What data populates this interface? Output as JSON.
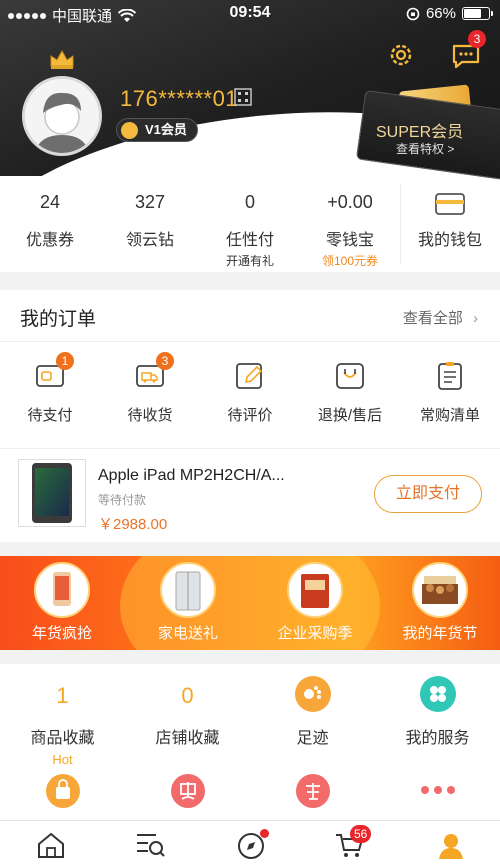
{
  "status_bar": {
    "carrier": "中国联通",
    "time": "09:54",
    "battery": "66%"
  },
  "profile": {
    "phone": "176******01",
    "vip_level": "V1会员",
    "message_badge": "3",
    "super_title": "SUPER会员",
    "super_sub": "查看特权 >"
  },
  "stats": [
    {
      "value": "24",
      "label": "优惠券",
      "sub": ""
    },
    {
      "value": "327",
      "label": "领云钻",
      "sub": ""
    },
    {
      "value": "0",
      "label": "任性付",
      "sub": "开通有礼"
    },
    {
      "value": "+0.00",
      "label": "零钱宝",
      "sub": "领100元券"
    },
    {
      "value": "",
      "label": "我的钱包",
      "sub": ""
    }
  ],
  "orders": {
    "title": "我的订单",
    "view_all": "查看全部",
    "items": [
      {
        "label": "待支付",
        "badge": "1",
        "icon": "wallet-pay-icon"
      },
      {
        "label": "待收货",
        "badge": "3",
        "icon": "truck-icon"
      },
      {
        "label": "待评价",
        "badge": "",
        "icon": "pencil-icon"
      },
      {
        "label": "退换/售后",
        "badge": "",
        "icon": "return-icon"
      },
      {
        "label": "常购清单",
        "badge": "",
        "icon": "list-icon"
      }
    ],
    "product": {
      "name": "Apple iPad MP2H2CH/A...",
      "status": "等待付款",
      "price": "￥2988.00",
      "pay_button": "立即支付"
    }
  },
  "banner": [
    {
      "label": "年货疯抢"
    },
    {
      "label": "家电送礼"
    },
    {
      "label": "企业采购季"
    },
    {
      "label": "我的年货节"
    }
  ],
  "services": {
    "row1": [
      {
        "num": "1",
        "label": "商品收藏",
        "hot": "Hot"
      },
      {
        "num": "0",
        "label": "店铺收藏",
        "hot": ""
      },
      {
        "label": "足迹"
      },
      {
        "label": "我的服务"
      }
    ]
  },
  "tabbar": {
    "cart_badge": "56"
  },
  "colors": {
    "accent": "#f5a623",
    "orange": "#e8742a",
    "red_badge": "#e8262b",
    "gold": "#f5b93e"
  }
}
